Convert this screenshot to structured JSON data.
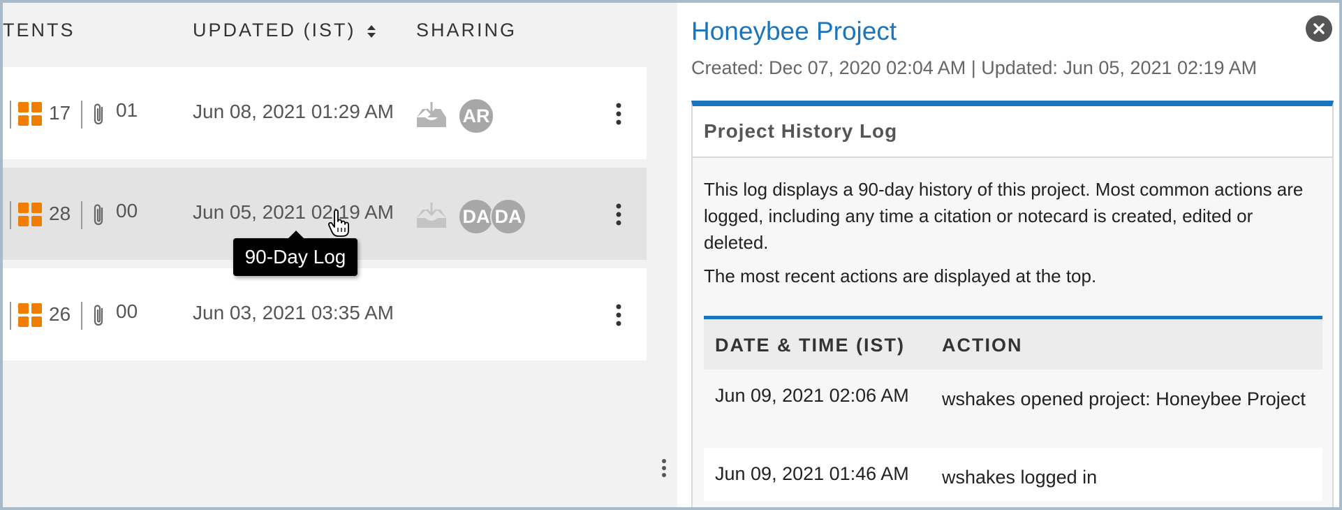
{
  "table": {
    "headers": {
      "contents": "TENTS",
      "updated": "UPDATED (IST)",
      "sharing": "SHARING"
    },
    "rows": [
      {
        "notecards": "17",
        "attachments": "01",
        "updated": "Jun 08, 2021 01:29 AM",
        "avatars": [
          "AR"
        ],
        "shared": true
      },
      {
        "notecards": "28",
        "attachments": "00",
        "updated": "Jun 05, 2021 02:19 AM",
        "avatars": [
          "DA",
          "DA"
        ],
        "shared": true
      },
      {
        "notecards": "26",
        "attachments": "00",
        "updated": "Jun 03, 2021 03:35 AM",
        "avatars": [],
        "shared": false
      }
    ],
    "tooltip": "90-Day Log"
  },
  "detail": {
    "title": "Honeybee Project",
    "meta": "Created: Dec 07, 2020 02:04 AM | Updated: Jun 05, 2021 02:19 AM",
    "log": {
      "heading": "Project History Log",
      "description": "This log displays a 90-day history of this project. Most common actions are logged, including any time a citation or notecard is created, edited or deleted.",
      "recent_note": "The most recent actions are displayed at the top.",
      "columns": {
        "date": "DATE & TIME (IST)",
        "action": "ACTION"
      },
      "entries": [
        {
          "date": "Jun 09, 2021 02:06 AM",
          "action": "wshakes opened project: Honeybee Project"
        },
        {
          "date": "Jun 09, 2021 01:46 AM",
          "action": "wshakes logged in"
        }
      ]
    }
  },
  "colors": {
    "accent": "#1a75bc",
    "grid_icon": "#f07d00",
    "avatar": "#a7a7a7"
  }
}
